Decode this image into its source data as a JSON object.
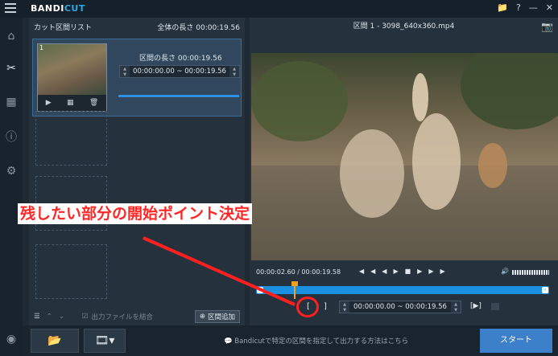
{
  "app": {
    "logo_text_a": "BANDI",
    "logo_text_b": "CUT"
  },
  "titlebar_icons": {
    "folder": "📁",
    "help": "?",
    "minimize": "—",
    "close": "✕"
  },
  "left": {
    "title": "カット区間リスト",
    "total_label": "全体の長さ 00:00:19.56",
    "clip": {
      "number": "1",
      "length_label": "区間の長さ 00:00:19.56",
      "range": "00:00:00.00 ~ 00:00:19.56",
      "progress": 1.0
    },
    "footer": {
      "merge_label": "出力ファイルを結合",
      "add_label": "区間追加"
    }
  },
  "right": {
    "title": "区間 1 - 3098_640x360.mp4",
    "time_display": "00:00:02.60 / 00:00:19.58",
    "playhead_fraction": 0.13,
    "range_label": "区間の長さ 00:00:19.56",
    "range_value": "00:00:00.00 ~ 00:00:19.56",
    "start_mark": "[",
    "end_mark": "]",
    "play_range": "[▶]"
  },
  "bottom": {
    "info_text": "Bandicutで特定の区間を指定して出力する方法はこちら",
    "start_label": "スタート"
  },
  "annotation": {
    "text": "残したい部分の開始ポイント決定",
    "color": "#ff2626"
  }
}
